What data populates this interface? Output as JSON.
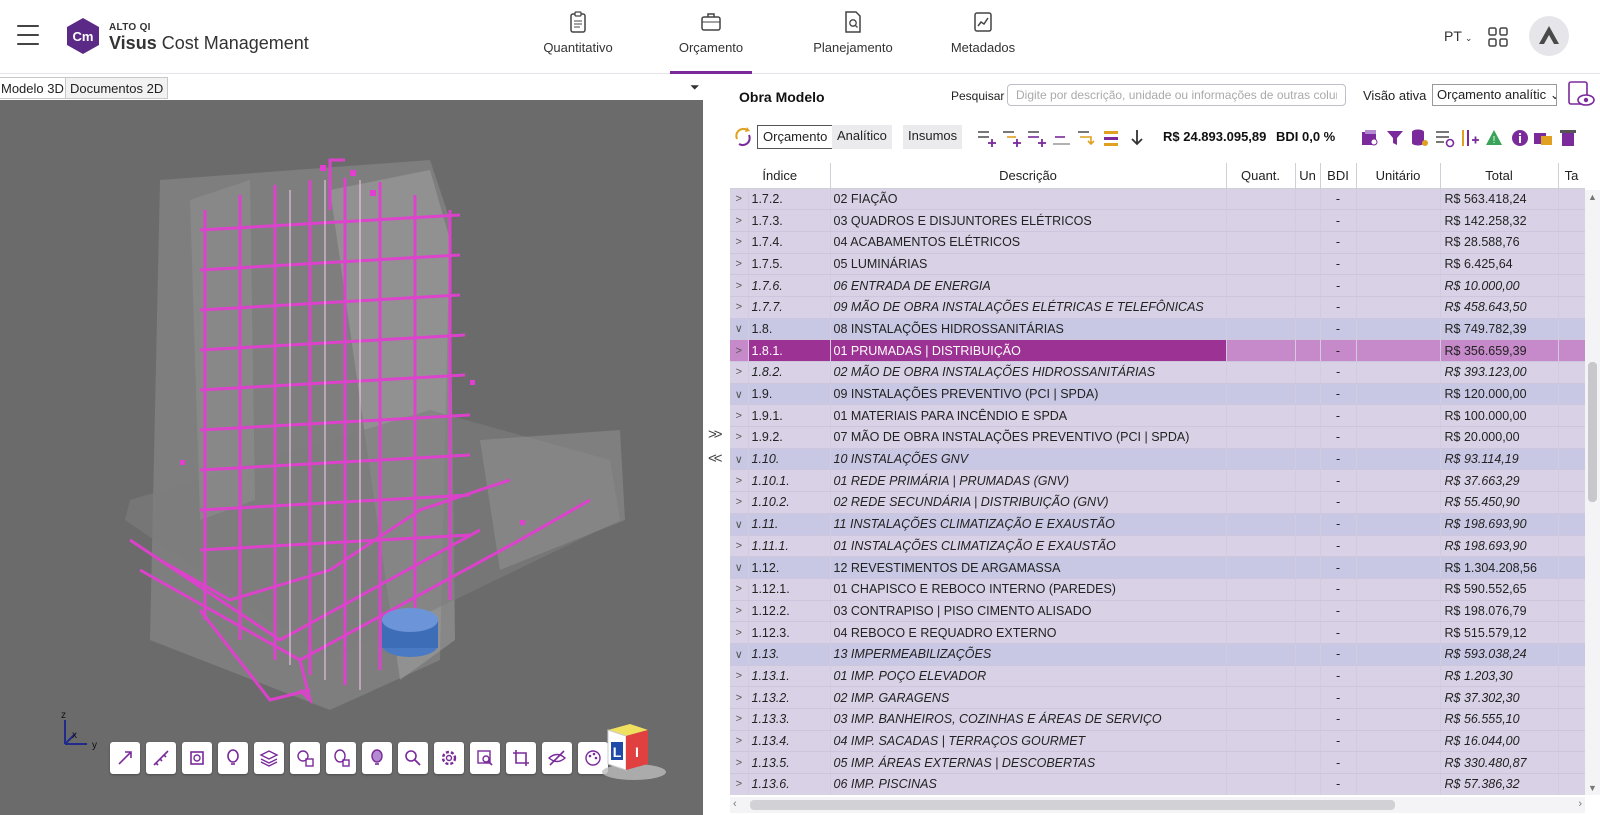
{
  "app": {
    "brand_small": "ALTO QI",
    "brand_bold": "Visus",
    "brand_rest": " Cost Management",
    "logo_text": "Cm"
  },
  "nav": {
    "tabs": [
      {
        "label": "Quantitativo",
        "icon": "clipboard-icon"
      },
      {
        "label": "Orçamento",
        "icon": "briefcase-icon",
        "active": true
      },
      {
        "label": "Planejamento",
        "icon": "document-search-icon"
      },
      {
        "label": "Metadados",
        "icon": "chart-document-icon"
      }
    ],
    "language": "PT"
  },
  "left_panel": {
    "tabs": [
      "Modelo 3D",
      "Documentos 2D"
    ],
    "active_tab": "Modelo 3D",
    "menu_glyph": "⏷",
    "axis_labels": {
      "z": "z",
      "x": "x",
      "y": "y"
    },
    "tools": [
      "explode-icon",
      "measure-icon",
      "section-icon",
      "highlight-icon",
      "layers-icon",
      "floors-icon",
      "isolate-icon",
      "bulb-icon",
      "inspect-icon",
      "settings-icon",
      "zoom-window-icon",
      "crop-icon",
      "hide-icon",
      "palette-icon"
    ]
  },
  "right_panel": {
    "title": "Obra Modelo",
    "search_label": "Pesquisar",
    "search_placeholder": "Digite por descrição, unidade ou informações de outras colunas.",
    "visao_label": "Visão ativa",
    "visao_value": "Orçamento analític",
    "segments": [
      "Orçamento",
      "Analítico",
      "Insumos"
    ],
    "active_segment": "Orçamento",
    "total_label": "R$ 24.893.095,89",
    "bdi_label": "BDI 0,0 %",
    "splitter_expand": ">>",
    "splitter_collapse": "<<"
  },
  "table": {
    "headers": [
      "Índice",
      "Descrição",
      "Quant.",
      "Un",
      "BDI",
      "Unitário",
      "Total",
      "Ta"
    ],
    "rows": [
      {
        "chev": ">",
        "index": "1.7.2.",
        "desc": "02 FIAÇÃO",
        "bdi": "-",
        "total": "R$ 563.418,24",
        "level": "lv2",
        "italic": false
      },
      {
        "chev": ">",
        "index": "1.7.3.",
        "desc": "03 QUADROS E DISJUNTORES ELÉTRICOS",
        "bdi": "-",
        "total": "R$ 142.258,32",
        "level": "lv2",
        "italic": false
      },
      {
        "chev": ">",
        "index": "1.7.4.",
        "desc": "04 ACABAMENTOS ELÉTRICOS",
        "bdi": "-",
        "total": "R$ 28.588,76",
        "level": "lv2",
        "italic": false
      },
      {
        "chev": ">",
        "index": "1.7.5.",
        "desc": "05 LUMINÁRIAS",
        "bdi": "-",
        "total": "R$ 6.425,64",
        "level": "lv2",
        "italic": false
      },
      {
        "chev": ">",
        "index": "1.7.6.",
        "desc": "06 ENTRADA DE ENERGIA",
        "bdi": "-",
        "total": "R$ 10.000,00",
        "level": "lv2",
        "italic": true
      },
      {
        "chev": ">",
        "index": "1.7.7.",
        "desc": "09 MÃO DE OBRA INSTALAÇÕES ELÉTRICAS E TELEFÔNICAS",
        "bdi": "-",
        "total": "R$ 458.643,50",
        "level": "lv2",
        "italic": true
      },
      {
        "chev": "∨",
        "index": "1.8.",
        "desc": "08 INSTALAÇÕES HIDROSSANITÁRIAS",
        "bdi": "-",
        "total": "R$ 749.782,39",
        "level": "lv1",
        "italic": false
      },
      {
        "chev": ">",
        "index": "1.8.1.",
        "desc": "01 PRUMADAS | DISTRIBUIÇÃO",
        "bdi": "-",
        "total": "R$ 356.659,39",
        "level": "sel",
        "italic": false
      },
      {
        "chev": ">",
        "index": "1.8.2.",
        "desc": "02 MÃO DE OBRA INSTALAÇÕES HIDROSSANITÁRIAS",
        "bdi": "-",
        "total": "R$ 393.123,00",
        "level": "lv2",
        "italic": true
      },
      {
        "chev": "∨",
        "index": "1.9.",
        "desc": "09 INSTALAÇÕES PREVENTIVO (PCI | SPDA)",
        "bdi": "-",
        "total": "R$ 120.000,00",
        "level": "lv1",
        "italic": false
      },
      {
        "chev": ">",
        "index": "1.9.1.",
        "desc": "01 MATERIAIS PARA INCÊNDIO E SPDA",
        "bdi": "-",
        "total": "R$ 100.000,00",
        "level": "lv2",
        "italic": false
      },
      {
        "chev": ">",
        "index": "1.9.2.",
        "desc": "07 MÃO DE OBRA INSTALAÇÕES PREVENTIVO (PCI | SPDA)",
        "bdi": "-",
        "total": "R$ 20.000,00",
        "level": "lv2",
        "italic": false
      },
      {
        "chev": "∨",
        "index": "1.10.",
        "desc": "10 INSTALAÇÕES GNV",
        "bdi": "-",
        "total": "R$ 93.114,19",
        "level": "lv1",
        "italic": true
      },
      {
        "chev": ">",
        "index": "1.10.1.",
        "desc": "01 REDE PRIMÁRIA | PRUMADAS (GNV)",
        "bdi": "-",
        "total": "R$ 37.663,29",
        "level": "lv2",
        "italic": true
      },
      {
        "chev": ">",
        "index": "1.10.2.",
        "desc": "02 REDE SECUNDÁRIA | DISTRIBUIÇÃO (GNV)",
        "bdi": "-",
        "total": "R$ 55.450,90",
        "level": "lv2",
        "italic": true
      },
      {
        "chev": "∨",
        "index": "1.11.",
        "desc": "11 INSTALAÇÕES CLIMATIZAÇÃO E EXAUSTÃO",
        "bdi": "-",
        "total": "R$ 198.693,90",
        "level": "lv1",
        "italic": true
      },
      {
        "chev": ">",
        "index": "1.11.1.",
        "desc": "01 INSTALAÇÕES CLIMATIZAÇÃO E EXAUSTÃO",
        "bdi": "-",
        "total": "R$ 198.693,90",
        "level": "lv2",
        "italic": true
      },
      {
        "chev": "∨",
        "index": "1.12.",
        "desc": "12 REVESTIMENTOS DE ARGAMASSA",
        "bdi": "-",
        "total": "R$ 1.304.208,56",
        "level": "lv1",
        "italic": false
      },
      {
        "chev": ">",
        "index": "1.12.1.",
        "desc": "01 CHAPISCO E REBOCO INTERNO (PAREDES)",
        "bdi": "-",
        "total": "R$ 590.552,65",
        "level": "lv2",
        "italic": false
      },
      {
        "chev": ">",
        "index": "1.12.2.",
        "desc": "03 CONTRAPISO | PISO CIMENTO ALISADO",
        "bdi": "-",
        "total": "R$ 198.076,79",
        "level": "lv2",
        "italic": false
      },
      {
        "chev": ">",
        "index": "1.12.3.",
        "desc": "04 REBOCO E REQUADRO EXTERNO",
        "bdi": "-",
        "total": "R$ 515.579,12",
        "level": "lv2",
        "italic": false
      },
      {
        "chev": "∨",
        "index": "1.13.",
        "desc": "13 IMPERMEABILIZAÇÕES",
        "bdi": "-",
        "total": "R$ 593.038,24",
        "level": "lv1",
        "italic": true
      },
      {
        "chev": ">",
        "index": "1.13.1.",
        "desc": "01 IMP. POÇO ELEVADOR",
        "bdi": "-",
        "total": "R$ 1.203,30",
        "level": "lv2",
        "italic": true
      },
      {
        "chev": ">",
        "index": "1.13.2.",
        "desc": "02 IMP. GARAGENS",
        "bdi": "-",
        "total": "R$ 37.302,30",
        "level": "lv2",
        "italic": true
      },
      {
        "chev": ">",
        "index": "1.13.3.",
        "desc": "03 IMP. BANHEIROS, COZINHAS E ÁREAS DE SERVIÇO",
        "bdi": "-",
        "total": "R$ 56.555,10",
        "level": "lv2",
        "italic": true
      },
      {
        "chev": ">",
        "index": "1.13.4.",
        "desc": "04 IMP. SACADAS | TERRAÇOS GOURMET",
        "bdi": "-",
        "total": "R$ 16.044,00",
        "level": "lv2",
        "italic": true
      },
      {
        "chev": ">",
        "index": "1.13.5.",
        "desc": "05 IMP. ÁREAS EXTERNAS | DESCOBERTAS",
        "bdi": "-",
        "total": "R$ 330.480,87",
        "level": "lv2",
        "italic": true
      },
      {
        "chev": ">",
        "index": "1.13.6.",
        "desc": "06 IMP. PISCINAS",
        "bdi": "-",
        "total": "R$ 57.386,32",
        "level": "lv2",
        "italic": true
      }
    ]
  },
  "colors": {
    "accent": "#7a2a9a",
    "pipes": "#e23fd0",
    "row_group": "#c9c8e4",
    "row_item": "#d9d2e6",
    "row_selected": "#9c3293"
  }
}
